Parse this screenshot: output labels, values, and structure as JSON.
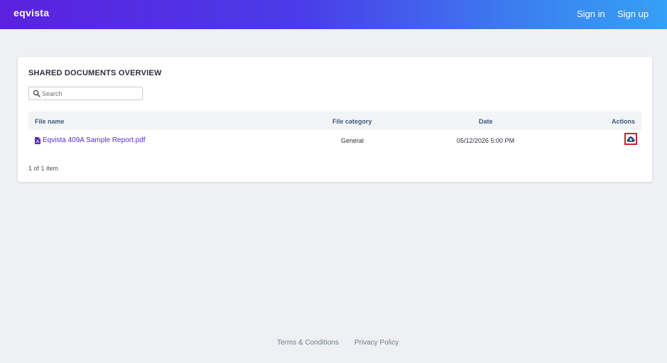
{
  "header": {
    "brand": "eqvista",
    "sign_in": "Sign in",
    "sign_up": "Sign up"
  },
  "documents": {
    "title": "SHARED DOCUMENTS OVERVIEW",
    "search": {
      "placeholder": "Search",
      "value": ""
    },
    "columns": {
      "file_name": "File name",
      "file_category": "File category",
      "date": "Date",
      "actions": "Actions"
    },
    "rows": [
      {
        "file_name": "Eqvista 409A Sample Report.pdf",
        "file_category": "General",
        "date": "05/12/2026 5:00 PM",
        "action_icon": "cloud-download-icon"
      }
    ],
    "pagination": "1 of 1 item"
  },
  "footer": {
    "terms": "Terms & Conditions",
    "privacy": "Privacy Policy"
  },
  "colors": {
    "header_gradient_start": "#5b21dc",
    "header_gradient_end": "#35a0f5",
    "link": "#5b2bcf",
    "column_header": "#3d5a80",
    "highlight_border": "#d0202b",
    "download_icon": "#2c4a70"
  }
}
